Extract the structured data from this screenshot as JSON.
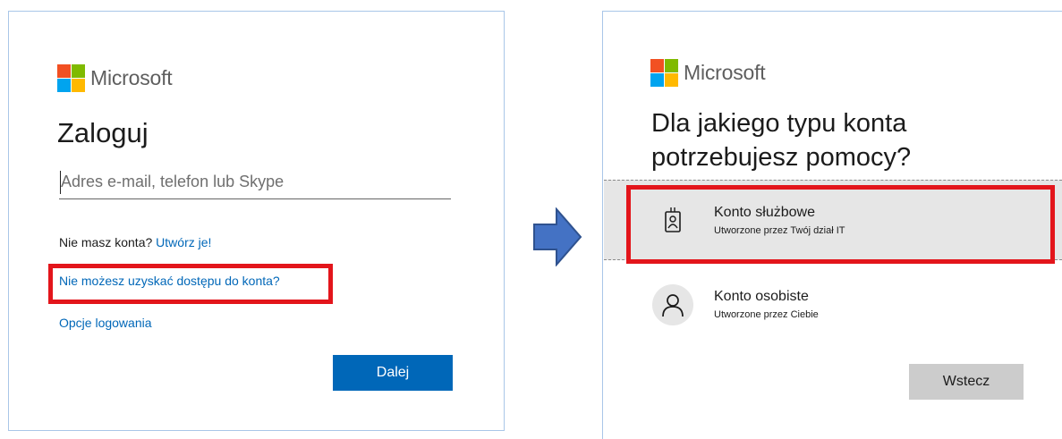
{
  "left": {
    "brand": "Microsoft",
    "title": "Zaloguj",
    "email_placeholder": "Adres e-mail, telefon lub Skype",
    "no_account_text": "Nie masz konta?",
    "create_link": "Utwórz je!",
    "cant_access_link": "Nie możesz uzyskać dostępu do konta?",
    "sign_in_options_link": "Opcje logowania",
    "next_button": "Dalej"
  },
  "right": {
    "brand": "Microsoft",
    "title_line1": "Dla jakiego typu konta",
    "title_line2": "potrzebujesz pomocy?",
    "options": [
      {
        "title": "Konto służbowe",
        "subtitle": "Utworzone przez Twój dział IT",
        "icon": "badge-icon"
      },
      {
        "title": "Konto osobiste",
        "subtitle": "Utworzone przez Ciebie",
        "icon": "person-icon"
      }
    ],
    "back_button": "Wstecz"
  },
  "colors": {
    "accent_blue": "#0067b8",
    "highlight_red": "#e3151b",
    "arrow_blue": "#4472c4",
    "selected_bg": "#e6e6e6"
  }
}
